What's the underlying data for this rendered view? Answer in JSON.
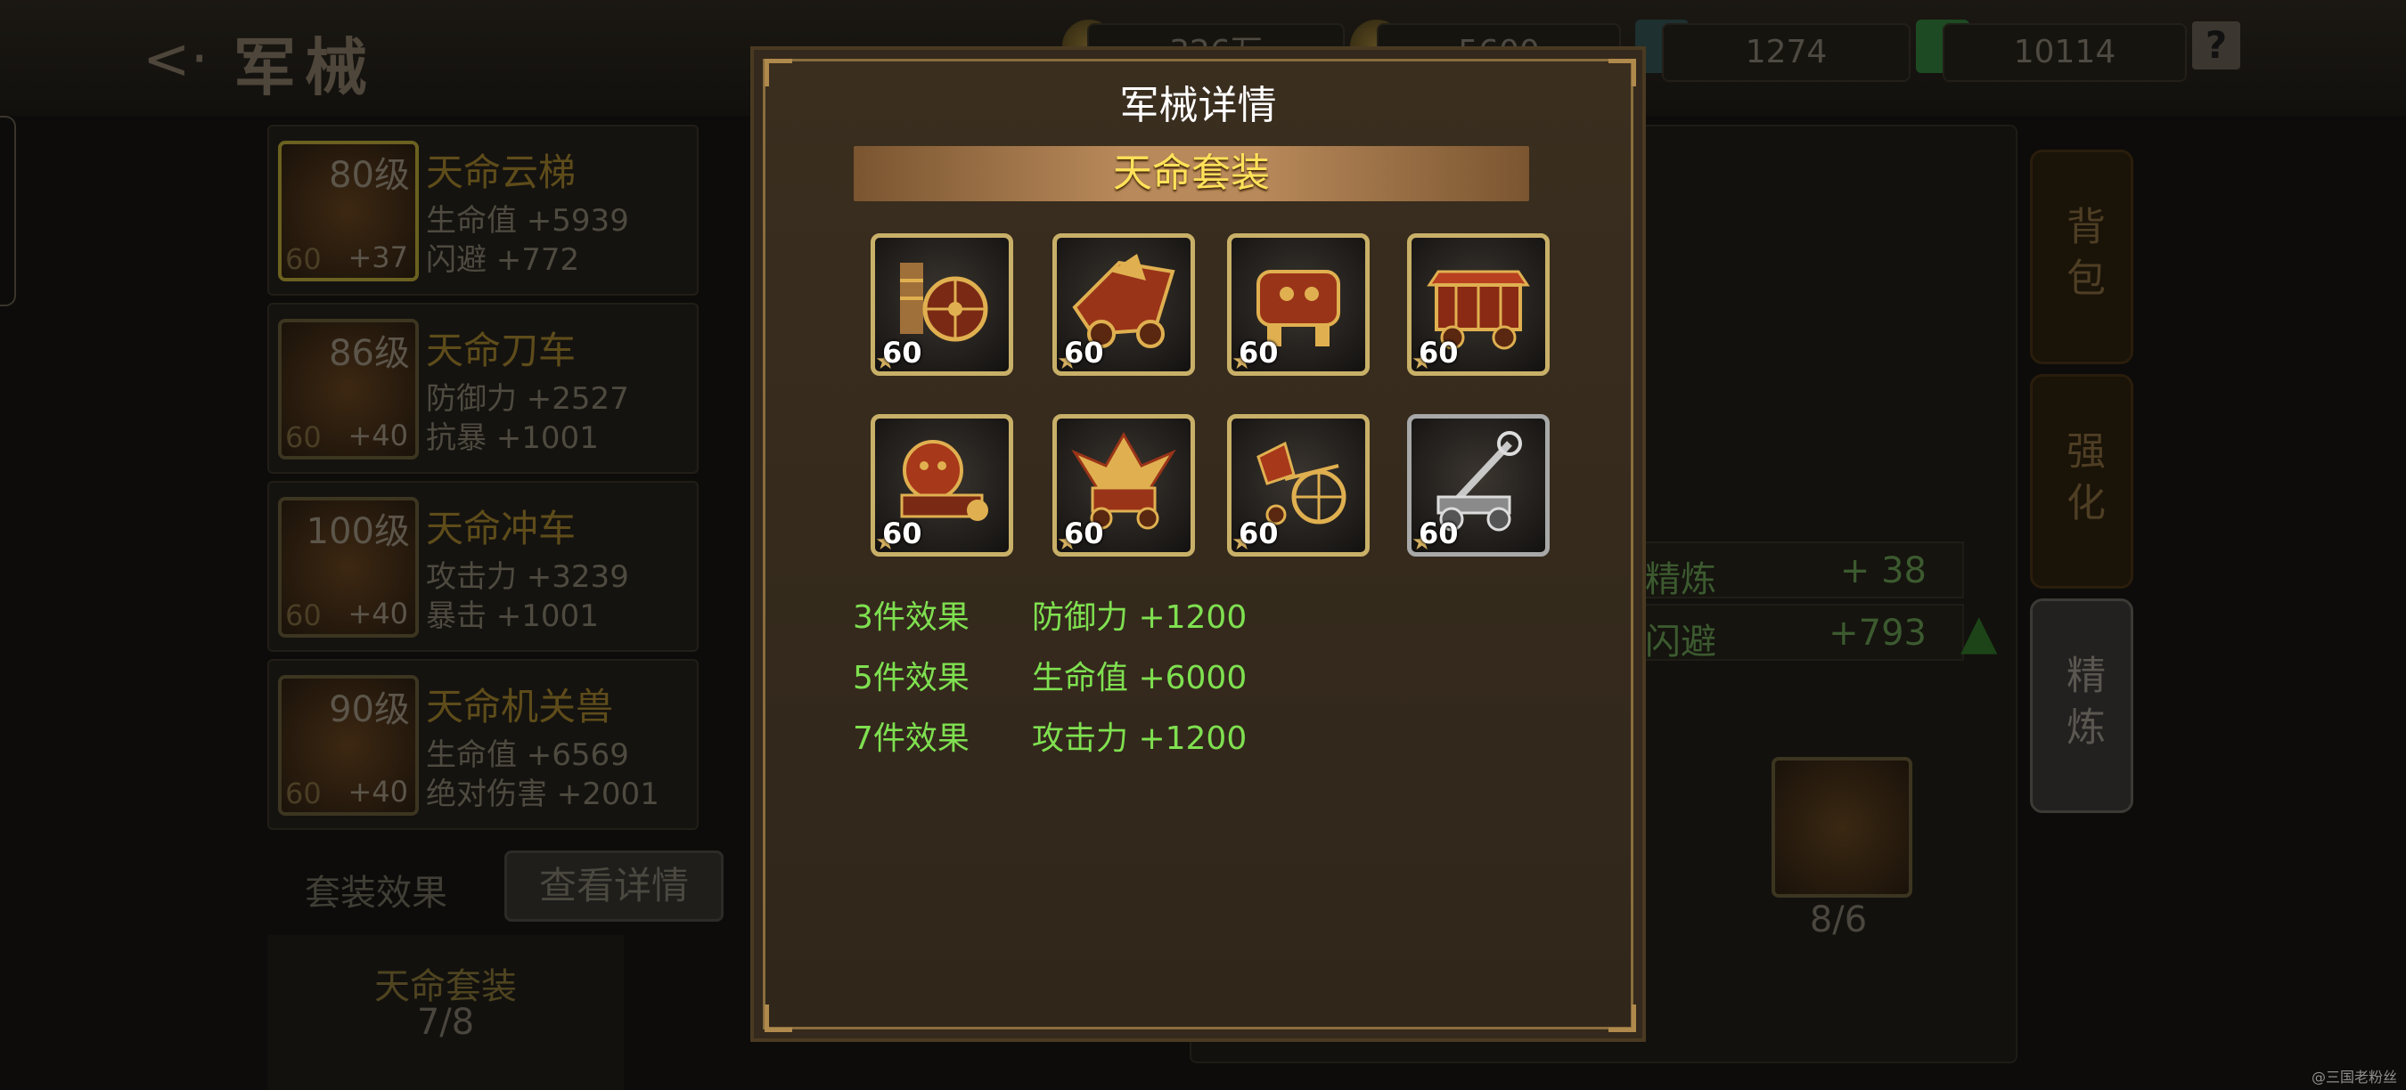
{
  "header": {
    "back_icon": "back-arrow-icon",
    "title": "军械",
    "resources": [
      "326万",
      "5600",
      "1274",
      "10114"
    ],
    "help_label": "?"
  },
  "cards": [
    {
      "level": "80级",
      "name": "天命云梯",
      "stat1": "生命值 +5939",
      "stat2": "闪避 +772",
      "star": "60",
      "plus": "+37"
    },
    {
      "level": "86级",
      "name": "天命刀车",
      "stat1": "防御力 +2527",
      "stat2": "抗暴 +1001",
      "star": "60",
      "plus": "+40"
    },
    {
      "level": "100级",
      "name": "天命冲车",
      "stat1": "攻击力 +3239",
      "stat2": "暴击 +1001",
      "star": "60",
      "plus": "+40"
    },
    {
      "level": "90级",
      "name": "天命机关兽",
      "stat1": "生命值 +6569",
      "stat2": "绝对伤害 +2001",
      "star": "60",
      "plus": "+40"
    }
  ],
  "set_effect": {
    "label": "套装效果",
    "detail_button": "查看详情",
    "set_name": "天命套装",
    "count": "7/8"
  },
  "side_buttons": [
    "背包",
    "强化",
    "精炼"
  ],
  "right_stats": [
    {
      "name": "精炼",
      "value": "+ 38"
    },
    {
      "name": "闪避",
      "value": "+793"
    }
  ],
  "fragment": {
    "count": "8/6"
  },
  "modal": {
    "title": "军械详情",
    "set_name": "天命套装",
    "items": [
      {
        "level": "60",
        "icon": "ladder-siege-icon"
      },
      {
        "level": "60",
        "icon": "dragon-cart-icon"
      },
      {
        "level": "60",
        "icon": "beast-cart-icon"
      },
      {
        "level": "60",
        "icon": "wagon-icon"
      },
      {
        "level": "60",
        "icon": "lion-ram-icon"
      },
      {
        "level": "60",
        "icon": "phoenix-cart-icon"
      },
      {
        "level": "60",
        "icon": "chariot-icon"
      },
      {
        "level": "60",
        "icon": "catapult-icon"
      }
    ],
    "effects": [
      {
        "label": "3件效果",
        "value": "防御力 +1200"
      },
      {
        "label": "5件效果",
        "value": "生命值 +6000"
      },
      {
        "label": "7件效果",
        "value": "攻击力 +1200"
      }
    ]
  },
  "watermark": "@三国老粉丝",
  "colors": {
    "effect_green": "#7fe050",
    "banner_gold": "#ffe25a",
    "item_gold_border": "#c9b068",
    "item_silver_border": "#a8a8a8"
  }
}
